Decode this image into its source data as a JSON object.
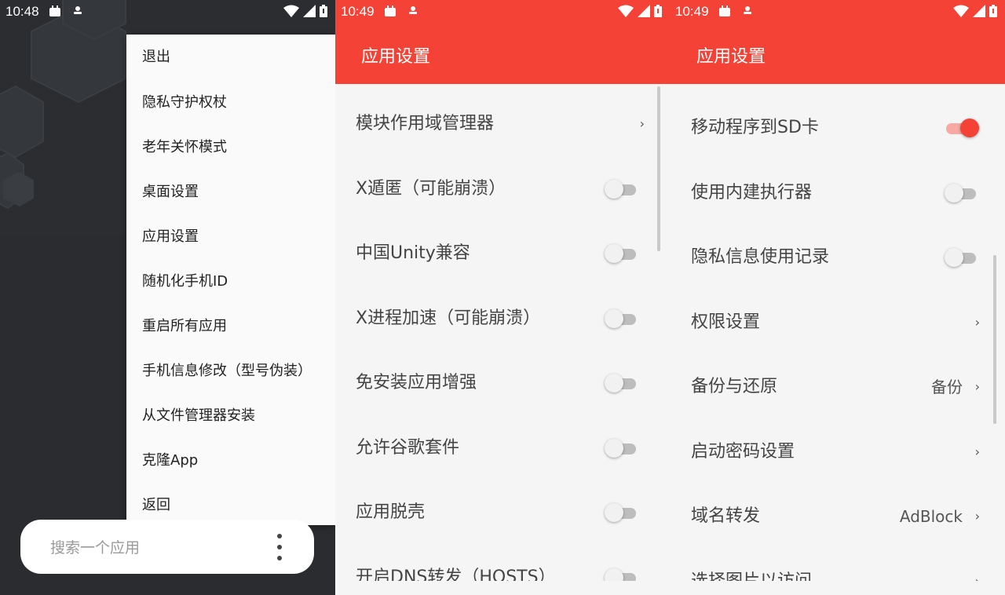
{
  "screens": [
    {
      "status_time": "10:48",
      "menu_items": [
        "退出",
        "隐私守护权杖",
        "老年关怀模式",
        "桌面设置",
        "应用设置",
        "随机化手机ID",
        "重启所有应用",
        "手机信息修改（型号伪装）",
        "从文件管理器安装",
        "克隆App",
        "返回"
      ],
      "search_placeholder": "搜索一个应用",
      "more_icon": "more-vert-icon"
    },
    {
      "status_time": "10:49",
      "title": "应用设置",
      "rows": [
        {
          "label": "模块作用域管理器",
          "control": "chevron",
          "chevron": "›"
        },
        {
          "label": "X遁匿（可能崩溃）",
          "control": "switch",
          "on": false
        },
        {
          "label": "中国Unity兼容",
          "control": "switch",
          "on": false
        },
        {
          "label": "X进程加速（可能崩溃）",
          "control": "switch",
          "on": false
        },
        {
          "label": "免安装应用增强",
          "control": "switch",
          "on": false
        },
        {
          "label": "允许谷歌套件",
          "control": "switch",
          "on": false
        },
        {
          "label": "应用脱壳",
          "control": "switch",
          "on": false
        },
        {
          "label": "开启DNS转发（HOSTS）",
          "control": "switch",
          "on": false
        }
      ]
    },
    {
      "status_time": "10:49",
      "title": "应用设置",
      "rows": [
        {
          "label": "移动程序到SD卡",
          "control": "switch",
          "on": true
        },
        {
          "label": "使用内建执行器",
          "control": "switch",
          "on": false
        },
        {
          "label": "隐私信息使用记录",
          "control": "switch",
          "on": false
        },
        {
          "label": "权限设置",
          "control": "chevron",
          "chevron": "›"
        },
        {
          "label": "备份与还原",
          "control": "chevron",
          "value": "备份",
          "chevron": "›"
        },
        {
          "label": "启动密码设置",
          "control": "chevron",
          "chevron": "›"
        },
        {
          "label": "域名转发",
          "control": "chevron",
          "value": "AdBlock",
          "chevron": "›"
        },
        {
          "label": "选择图片以访问",
          "control": "chevron",
          "chevron": "›"
        }
      ]
    }
  ],
  "colors": {
    "accent": "#f44336",
    "switch_on_track": "#f8a9a4",
    "switch_off_track": "#bdbdbd",
    "background": "#f5f5f5",
    "launcher_bg": "#2b2d30"
  },
  "status_icons": [
    "android-icon",
    "user-icon",
    "wifi-icon",
    "signal-icon",
    "battery-icon"
  ]
}
